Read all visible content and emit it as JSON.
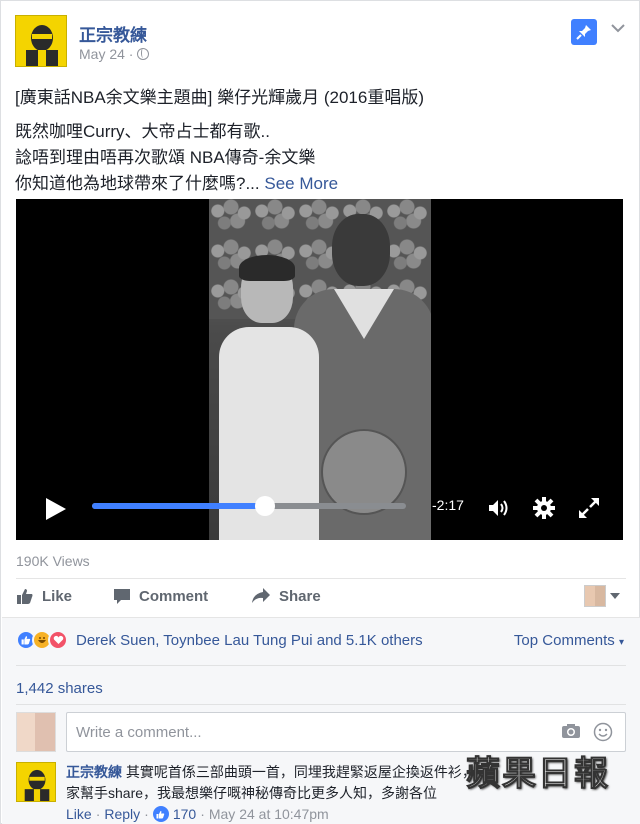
{
  "post": {
    "page_name": "正宗教練",
    "date": "May 24 · ",
    "lines": [
      "[廣東話NBA余文樂主題曲] 樂仔光輝歲月 (2016重唱版)",
      "既然咖哩Curry、大帝占士都有歌..",
      "諗唔到理由唔再次歌頌 NBA傳奇-余文樂",
      "你知道他為地球帶來了什麼嗎?... "
    ],
    "see_more": "See More"
  },
  "video": {
    "time_remaining": "-2:17",
    "progress": 0.55
  },
  "views": "190K Views",
  "actions": {
    "like": "Like",
    "comment": "Comment",
    "share": "Share"
  },
  "reactions": {
    "names": "Derek Suen, Toynbee Lau Tung Pui and 5.1K others",
    "top_comments": "Top Comments"
  },
  "shares": "1,442 shares",
  "comment_input": {
    "placeholder": "Write a comment..."
  },
  "comment": {
    "author": "正宗教練",
    "text_line1": " 其實呢首係三部曲頭一首，同埋我趕緊返屋企換返件衫，",
    "text_line2": "家幫手share，我最想樂仔嘅神秘傳奇比更多人知，多謝各位",
    "like": "Like",
    "reply": "Reply",
    "like_count": "170",
    "timestamp": "May 24 at 10:47pm"
  },
  "watermark": "蘋果日報",
  "colors": {
    "link": "#365899",
    "accent": "#4080ff",
    "muted": "#90949c"
  }
}
